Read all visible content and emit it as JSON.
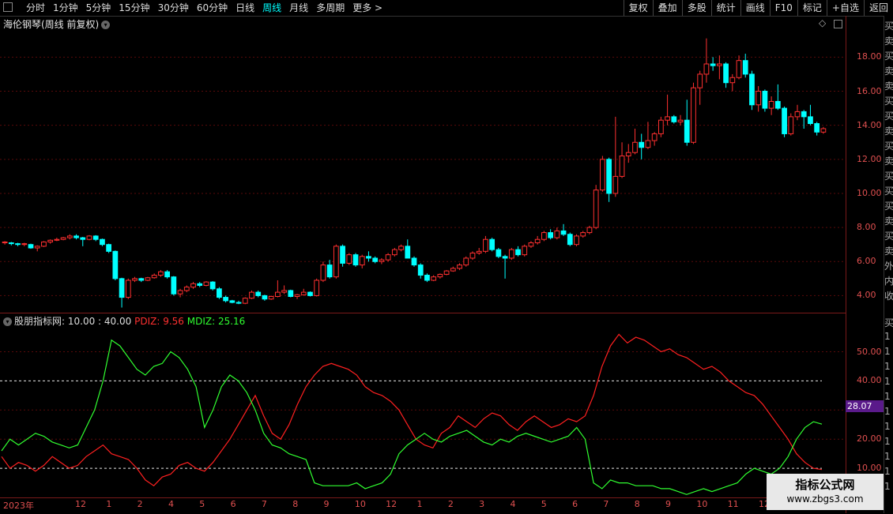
{
  "toolbar": {
    "tabs": [
      {
        "label": "分时",
        "active": false
      },
      {
        "label": "1分钟",
        "active": false
      },
      {
        "label": "5分钟",
        "active": false
      },
      {
        "label": "15分钟",
        "active": false
      },
      {
        "label": "30分钟",
        "active": false
      },
      {
        "label": "60分钟",
        "active": false
      },
      {
        "label": "日线",
        "active": false
      },
      {
        "label": "周线",
        "active": true
      },
      {
        "label": "月线",
        "active": false
      },
      {
        "label": "多周期",
        "active": false
      },
      {
        "label": "更多 >",
        "active": false
      }
    ],
    "actions": [
      "复权",
      "叠加",
      "多股",
      "统计",
      "画线",
      "F10",
      "标记",
      "+自选",
      "返回"
    ]
  },
  "price_panel": {
    "title": "海伦钢琴(周线 前复权)",
    "y_labels": [
      "18.00",
      "16.00",
      "14.00",
      "12.00",
      "10.00",
      "8.00",
      "6.00",
      "4.00"
    ]
  },
  "indicator_panel": {
    "name": "股朋指标网",
    "params": ": 10.00 : 40.00",
    "pdiz_label": "PDIZ: 9.56",
    "mdiz_label": "MDIZ: 25.16",
    "y_labels": [
      "50.00",
      "40.00",
      "30.00",
      "20.00",
      "10.00"
    ],
    "highlight_value": "28.07"
  },
  "x_axis": {
    "labels": [
      "2023年",
      "12",
      "1",
      "2",
      "4",
      "5",
      "6",
      "7",
      "8",
      "9",
      "10",
      "12",
      "1",
      "2",
      "3",
      "4",
      "5",
      "6",
      "7",
      "8",
      "9",
      "10",
      "11",
      "12"
    ]
  },
  "right_panel_chars": [
    "买",
    "卖",
    "买",
    "卖",
    "卖",
    "买",
    "买",
    "卖",
    "买",
    "卖",
    "买",
    "买",
    "买",
    "卖",
    "买",
    "卖",
    "外",
    "内",
    "收"
  ],
  "right_panel_chars2": [
    "买",
    "1",
    "1",
    "1",
    "1",
    "1",
    "1",
    "1",
    "1",
    "1",
    "1",
    "1"
  ],
  "watermark": {
    "line1": "指标公式网",
    "line2": "www.zbgs3.com"
  },
  "colors": {
    "up": "#ff3030",
    "down": "#00ffff",
    "pdiz": "#ff2020",
    "mdiz": "#30ff30",
    "grid": "#5a0a0a"
  },
  "chart_data": [
    {
      "type": "candlestick",
      "title": "海伦钢琴(周线 前复权)",
      "ylim": [
        3.0,
        19.5
      ],
      "candles": [
        [
          7.1,
          7.2,
          7.0,
          7.15
        ],
        [
          7.1,
          7.15,
          6.95,
          7.05
        ],
        [
          7.05,
          7.1,
          6.9,
          7.0
        ],
        [
          7.0,
          7.1,
          6.9,
          7.05
        ],
        [
          7.0,
          7.05,
          6.75,
          6.8
        ],
        [
          6.8,
          6.95,
          6.6,
          6.9
        ],
        [
          6.9,
          7.2,
          6.85,
          7.15
        ],
        [
          7.15,
          7.3,
          7.05,
          7.25
        ],
        [
          7.25,
          7.4,
          7.2,
          7.3
        ],
        [
          7.3,
          7.45,
          7.25,
          7.4
        ],
        [
          7.4,
          7.6,
          7.3,
          7.5
        ],
        [
          7.5,
          7.6,
          7.3,
          7.4
        ],
        [
          7.4,
          7.45,
          6.9,
          7.3
        ],
        [
          7.3,
          7.55,
          7.25,
          7.5
        ],
        [
          7.5,
          7.55,
          7.2,
          7.3
        ],
        [
          7.3,
          7.35,
          6.9,
          7.0
        ],
        [
          7.0,
          7.05,
          6.5,
          6.6
        ],
        [
          6.6,
          6.65,
          4.9,
          5.0
        ],
        [
          5.0,
          5.05,
          3.3,
          3.9
        ],
        [
          3.9,
          5.0,
          3.8,
          4.9
        ],
        [
          4.9,
          5.1,
          4.8,
          5.0
        ],
        [
          5.0,
          5.05,
          4.8,
          4.9
        ],
        [
          4.9,
          5.1,
          4.85,
          5.05
        ],
        [
          5.05,
          5.3,
          5.0,
          5.2
        ],
        [
          5.2,
          5.5,
          5.1,
          5.4
        ],
        [
          5.4,
          5.5,
          5.0,
          5.1
        ],
        [
          5.1,
          5.15,
          4.0,
          4.1
        ],
        [
          4.1,
          4.4,
          3.9,
          4.3
        ],
        [
          4.3,
          4.6,
          4.2,
          4.5
        ],
        [
          4.5,
          4.8,
          4.4,
          4.7
        ],
        [
          4.7,
          4.8,
          4.5,
          4.6
        ],
        [
          4.6,
          4.85,
          4.55,
          4.8
        ],
        [
          4.8,
          4.85,
          4.3,
          4.4
        ],
        [
          4.4,
          4.5,
          3.8,
          3.9
        ],
        [
          3.9,
          4.0,
          3.6,
          3.7
        ],
        [
          3.7,
          3.75,
          3.55,
          3.6
        ],
        [
          3.6,
          3.7,
          3.5,
          3.55
        ],
        [
          3.55,
          3.9,
          3.5,
          3.85
        ],
        [
          3.85,
          4.3,
          3.8,
          4.2
        ],
        [
          4.2,
          4.3,
          3.9,
          4.0
        ],
        [
          4.0,
          4.05,
          3.7,
          3.8
        ],
        [
          3.8,
          4.0,
          3.75,
          3.95
        ],
        [
          3.95,
          4.9,
          3.9,
          4.2
        ],
        [
          4.2,
          4.6,
          4.1,
          4.3
        ],
        [
          4.3,
          4.35,
          3.9,
          3.95
        ],
        [
          3.95,
          4.1,
          3.8,
          4.05
        ],
        [
          4.05,
          4.4,
          4.0,
          4.2
        ],
        [
          4.2,
          4.25,
          3.95,
          4.0
        ],
        [
          4.0,
          5.0,
          3.95,
          4.9
        ],
        [
          4.9,
          6.0,
          4.8,
          5.8
        ],
        [
          5.8,
          6.1,
          5.0,
          5.1
        ],
        [
          5.1,
          7.0,
          5.0,
          6.9
        ],
        [
          6.9,
          7.0,
          5.7,
          5.9
        ],
        [
          5.9,
          6.5,
          5.8,
          6.4
        ],
        [
          6.4,
          6.5,
          5.7,
          5.8
        ],
        [
          5.8,
          6.4,
          5.6,
          6.3
        ],
        [
          6.3,
          6.6,
          6.0,
          6.2
        ],
        [
          6.2,
          6.3,
          5.9,
          6.0
        ],
        [
          6.0,
          6.2,
          5.85,
          6.1
        ],
        [
          6.1,
          6.5,
          6.0,
          6.4
        ],
        [
          6.4,
          6.8,
          6.3,
          6.7
        ],
        [
          6.7,
          7.0,
          6.6,
          6.9
        ],
        [
          6.9,
          7.3,
          6.85,
          6.2
        ],
        [
          6.2,
          6.3,
          5.7,
          5.8
        ],
        [
          5.8,
          5.9,
          5.0,
          5.2
        ],
        [
          5.2,
          5.3,
          4.8,
          4.9
        ],
        [
          4.9,
          5.2,
          4.85,
          5.1
        ],
        [
          5.1,
          5.3,
          5.0,
          5.25
        ],
        [
          5.25,
          5.5,
          5.2,
          5.45
        ],
        [
          5.45,
          5.7,
          5.4,
          5.6
        ],
        [
          5.6,
          5.9,
          5.5,
          5.8
        ],
        [
          5.8,
          6.3,
          5.7,
          6.2
        ],
        [
          6.2,
          6.6,
          6.1,
          6.5
        ],
        [
          6.5,
          6.8,
          6.4,
          6.6
        ],
        [
          6.6,
          7.5,
          6.5,
          7.3
        ],
        [
          7.3,
          7.4,
          6.6,
          6.7
        ],
        [
          6.7,
          6.8,
          6.2,
          6.3
        ],
        [
          6.3,
          6.4,
          5.0,
          6.2
        ],
        [
          6.2,
          6.8,
          6.1,
          6.7
        ],
        [
          6.7,
          6.9,
          6.3,
          6.4
        ],
        [
          6.4,
          7.0,
          6.3,
          6.9
        ],
        [
          6.9,
          7.2,
          6.8,
          7.1
        ],
        [
          7.1,
          7.5,
          7.0,
          7.3
        ],
        [
          7.3,
          7.8,
          7.2,
          7.7
        ],
        [
          7.7,
          7.9,
          7.3,
          7.4
        ],
        [
          7.4,
          8.0,
          7.3,
          7.8
        ],
        [
          7.8,
          8.2,
          7.5,
          7.6
        ],
        [
          7.6,
          7.7,
          6.9,
          7.0
        ],
        [
          7.0,
          7.6,
          6.9,
          7.5
        ],
        [
          7.5,
          7.8,
          7.4,
          7.7
        ],
        [
          7.7,
          8.1,
          7.6,
          8.0
        ],
        [
          8.0,
          10.5,
          7.9,
          10.2
        ],
        [
          10.2,
          12.2,
          10.1,
          12.0
        ],
        [
          12.0,
          12.1,
          9.5,
          10.0
        ],
        [
          10.0,
          14.5,
          9.8,
          11.0
        ],
        [
          11.0,
          13.0,
          10.9,
          12.2
        ],
        [
          12.2,
          12.9,
          11.8,
          12.4
        ],
        [
          12.4,
          13.8,
          12.3,
          13.0
        ],
        [
          13.0,
          13.5,
          12.0,
          12.7
        ],
        [
          12.7,
          14.2,
          12.6,
          13.1
        ],
        [
          13.1,
          13.6,
          12.8,
          13.5
        ],
        [
          13.5,
          14.5,
          13.3,
          14.3
        ],
        [
          14.3,
          15.8,
          14.0,
          14.5
        ],
        [
          14.5,
          14.6,
          14.1,
          14.2
        ],
        [
          14.2,
          14.6,
          14.0,
          14.3
        ],
        [
          14.3,
          15.5,
          12.8,
          13.0
        ],
        [
          13.0,
          16.5,
          12.9,
          16.2
        ],
        [
          16.2,
          17.2,
          15.2,
          17.0
        ],
        [
          17.0,
          19.1,
          16.5,
          17.6
        ],
        [
          17.6,
          18.0,
          17.2,
          17.5
        ],
        [
          17.5,
          18.1,
          16.7,
          17.6
        ],
        [
          17.6,
          17.7,
          16.2,
          16.5
        ],
        [
          16.5,
          17.0,
          16.0,
          16.8
        ],
        [
          16.8,
          18.1,
          16.7,
          17.8
        ],
        [
          17.8,
          18.2,
          16.8,
          17.0
        ],
        [
          17.0,
          17.2,
          14.9,
          15.2
        ],
        [
          15.2,
          16.3,
          14.8,
          16.0
        ],
        [
          16.0,
          16.1,
          14.8,
          15.0
        ],
        [
          15.0,
          15.7,
          14.6,
          15.4
        ],
        [
          15.4,
          16.4,
          14.9,
          15.0
        ],
        [
          15.0,
          15.1,
          13.3,
          13.5
        ],
        [
          13.5,
          14.7,
          13.4,
          14.5
        ],
        [
          14.5,
          15.2,
          14.3,
          14.8
        ],
        [
          14.8,
          14.9,
          13.8,
          14.5
        ],
        [
          14.5,
          15.2,
          14.0,
          14.1
        ],
        [
          14.1,
          14.2,
          13.4,
          13.6
        ],
        [
          13.6,
          13.9,
          13.5,
          13.8
        ]
      ]
    },
    {
      "type": "line",
      "title": "股朋指标网",
      "ylim": [
        0,
        58
      ],
      "reference_lines": [
        10,
        40
      ],
      "series": [
        {
          "name": "PDIZ",
          "values": [
            14,
            10,
            12,
            11,
            9,
            11,
            14,
            12,
            10,
            11,
            14,
            16,
            18,
            15,
            14,
            13,
            10,
            6,
            4,
            7,
            8,
            11,
            12,
            10,
            9,
            12,
            16,
            20,
            25,
            30,
            35,
            28,
            22,
            20,
            25,
            32,
            38,
            42,
            45,
            46,
            45,
            44,
            42,
            38,
            36,
            35,
            33,
            30,
            25,
            20,
            18,
            17,
            22,
            24,
            28,
            26,
            24,
            27,
            29,
            28,
            25,
            23,
            26,
            28,
            26,
            24,
            25,
            27,
            26,
            28,
            35,
            45,
            52,
            56,
            53,
            55,
            54,
            52,
            50,
            51,
            49,
            48,
            46,
            44,
            45,
            43,
            40,
            38,
            36,
            35,
            32,
            28,
            24,
            20,
            15,
            12,
            10,
            9.56
          ]
        },
        {
          "name": "MDIZ",
          "values": [
            16,
            20,
            18,
            20,
            22,
            21,
            19,
            18,
            17,
            18,
            24,
            30,
            40,
            54,
            52,
            48,
            44,
            42,
            45,
            46,
            50,
            48,
            44,
            38,
            24,
            30,
            38,
            42,
            40,
            36,
            30,
            22,
            18,
            17,
            15,
            14,
            13,
            5,
            4,
            4,
            4,
            4,
            5,
            3,
            4,
            5,
            8,
            15,
            18,
            20,
            22,
            20,
            19,
            21,
            22,
            23,
            21,
            19,
            18,
            20,
            19,
            21,
            22,
            21,
            20,
            19,
            20,
            21,
            24,
            20,
            5,
            3,
            6,
            5,
            5,
            4,
            4,
            4,
            3,
            3,
            2,
            1,
            2,
            3,
            2,
            3,
            4,
            5,
            8,
            10,
            9,
            8,
            10,
            14,
            20,
            24,
            26,
            25.16
          ]
        }
      ]
    }
  ]
}
